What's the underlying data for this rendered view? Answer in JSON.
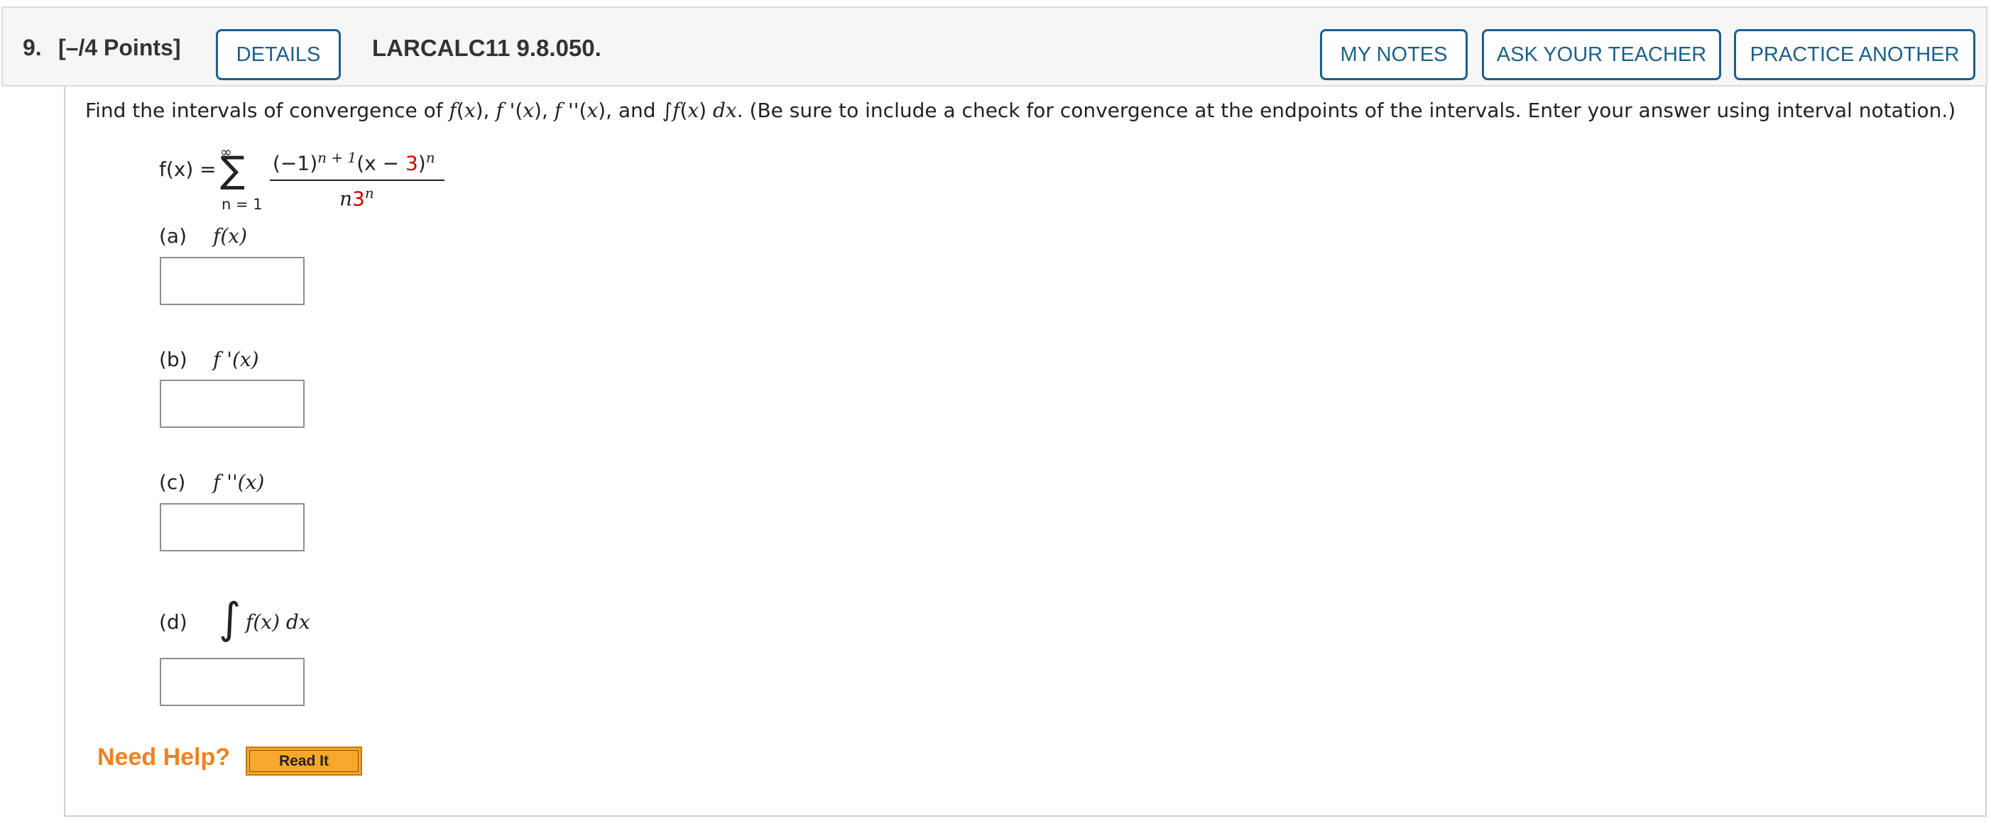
{
  "header": {
    "question_number": "9.",
    "points": "[–/4 Points]",
    "details_label": "DETAILS",
    "problem_code": "LARCALC11 9.8.050.",
    "my_notes_label": "MY NOTES",
    "ask_teacher_label": "ASK YOUR TEACHER",
    "practice_another_label": "PRACTICE ANOTHER"
  },
  "question": {
    "instruction_prefix": "Find the intervals of convergence of ",
    "instruction_suffix": " (Be sure to include a check for convergence at the endpoints of the intervals. Enter your answer using interval notation.)",
    "series": {
      "lhs": "f(x) =",
      "sum_upper": "∞",
      "sum_lower": "n = 1",
      "numerator_prefix": "(−1)",
      "numerator_exp": "n + 1",
      "numerator_mid": "(x − ",
      "shift": "3",
      "numerator_close": ")",
      "numerator_exp2": "n",
      "denominator_n": "n",
      "denominator_base": "3",
      "denominator_exp": "n"
    }
  },
  "parts": [
    {
      "letter": "(a)",
      "expr": "f(x)",
      "value": ""
    },
    {
      "letter": "(b)",
      "expr": "f '(x)",
      "value": ""
    },
    {
      "letter": "(c)",
      "expr": "f ''(x)",
      "value": ""
    },
    {
      "letter": "(d)",
      "expr": "f(x) dx",
      "value": ""
    }
  ],
  "help": {
    "label": "Need Help?",
    "read_it_label": "Read It"
  },
  "colors": {
    "accent_blue": "#1d5f8a",
    "variable_red": "#cc0000",
    "help_orange": "#f0821e",
    "read_it_bg": "#f7a72c"
  }
}
